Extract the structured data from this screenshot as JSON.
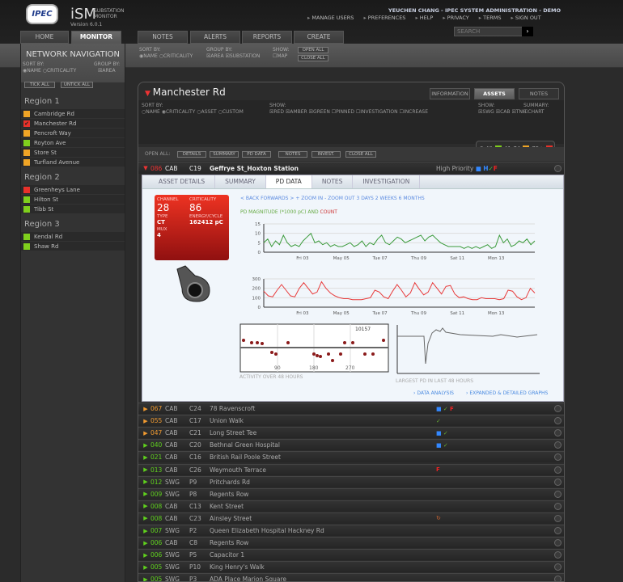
{
  "app": {
    "logo": "IPEC",
    "name": "iSM",
    "subtitle": "SUBSTATION MONITOR",
    "version": "Version 6.0.1"
  },
  "user": {
    "line": "YEUCHEN CHANG - IPEC SYSTEM ADMINISTRATION - DEMO",
    "links": [
      "MANAGE USERS",
      "PREFERENCES",
      "HELP",
      "PRIVACY",
      "TERMS",
      "SIGN OUT"
    ]
  },
  "search": {
    "placeholder": "SEARCH"
  },
  "tabs": [
    "HOME",
    "MONITOR",
    "NOTES",
    "ALERTS",
    "REPORTS",
    "CREATE"
  ],
  "active_tab": "MONITOR",
  "toolbar": {
    "sort_by": "SORT BY:",
    "sort_options": [
      "NAME",
      "CRITICALITY"
    ],
    "group_by": "GROUP BY:",
    "group_options": [
      "AREA",
      "SUBSTATION"
    ],
    "show": "SHOW:",
    "show_options": [
      "MAP"
    ],
    "open_all": "OPEN ALL",
    "close_all": "CLOSE ALL"
  },
  "nav": {
    "title": "NETWORK NAVIGATION",
    "sort_by": "SORT BY:",
    "sort_options": [
      "NAME",
      "CRITICALITY"
    ],
    "group_by": "GROUP BY:",
    "group_option": "AREA",
    "tick_all": "TICK ALL",
    "untick_all": "UNTICK ALL",
    "regions": [
      {
        "name": "Region 1",
        "items": [
          {
            "name": "Cambridge Rd",
            "status": "amber"
          },
          {
            "name": "Manchester Rd",
            "status": "red",
            "checked": true
          },
          {
            "name": "Pencroft Way",
            "status": "amber"
          },
          {
            "name": "Royton Ave",
            "status": "green"
          },
          {
            "name": "Store St",
            "status": "amber"
          },
          {
            "name": "Turfland Avenue",
            "status": "amber"
          }
        ]
      },
      {
        "name": "Region 2",
        "items": [
          {
            "name": "Greenheys Lane",
            "status": "red"
          },
          {
            "name": "Hilton St",
            "status": "green"
          },
          {
            "name": "Tibb St",
            "status": "green"
          }
        ]
      },
      {
        "name": "Region 3",
        "items": [
          {
            "name": "Kendal Rd",
            "status": "green"
          },
          {
            "name": "Shaw Rd",
            "status": "green"
          }
        ]
      }
    ]
  },
  "colors": {
    "red": "#e8312a",
    "amber": "#f0a526",
    "green": "#7fcf1d",
    "orange_text": "#f09a30",
    "green_text": "#5fd01d"
  },
  "panel": {
    "title": "Manchester Rd",
    "tabs": [
      "INFORMATION",
      "ASSETS",
      "NOTES"
    ],
    "active_tab": "ASSETS",
    "sort_label": "SORT BY:",
    "sort_options": [
      "NAME",
      "CRITICALITY",
      "ASSET",
      "CUSTOM"
    ],
    "show_label": "SHOW:",
    "show_options": [
      "RED",
      "AMBER",
      "GREEN",
      "PINNED",
      "INVESTIGATION",
      "INCREASE"
    ],
    "show2_label": "SHOW:",
    "show2_options": [
      "SWG",
      "CAB",
      "TNH"
    ],
    "summary_label": "SUMMARY:",
    "summary_option": "CHART",
    "legend": [
      "0-40",
      "41-74",
      "75+"
    ],
    "open_all_label": "OPEN ALL:",
    "open_buttons": [
      "DETAILS",
      "SUMMARY",
      "PD DATA",
      "NOTES",
      "INVEST.",
      "CLOSE ALL"
    ]
  },
  "expanded": {
    "num": "086",
    "type": "CAB",
    "code": "C19",
    "name": "Geffrye St_Hoxton Station",
    "priority": "High Priority",
    "tabs": [
      "ASSET DETAILS",
      "SUMMARY",
      "PD DATA",
      "NOTES",
      "INVESTIGATION"
    ],
    "active_tab": "PD DATA",
    "card": {
      "channel_label": "CHANNEL",
      "channel": "28",
      "crit_label": "CRITICALITY",
      "crit": "86",
      "type_label": "TYPE",
      "type": "CT",
      "energy_label": "ENERGY/CYCLE",
      "energy": "162412 pC",
      "mux_label": "MUX",
      "mux": "4"
    },
    "nav_links": "< BACK FORWARDS > + ZOOM IN - ZOOM OUT 3 DAYS 2 WEEKS 6 MONTHS",
    "pd_label_a": "PD MAGNITUDE (*1000 pC) AND ",
    "pd_label_b": "COUNT",
    "activity_label": "ACTIVITY OVER 48 HOURS",
    "largest_label": "LARGEST PD IN LAST 48 HOURS",
    "activity_value": "10157",
    "activity_ticks": [
      "90",
      "180",
      "270"
    ],
    "data_analysis": "DATA ANALYSIS",
    "expanded_graphs": "EXPANDED & DETAILED GRAPHS"
  },
  "chart_data": [
    {
      "type": "line",
      "title": "PD MAGNITUDE (*1000 pC)",
      "ylim": [
        0,
        15
      ],
      "yticks": [
        "0",
        "5",
        "10",
        "15"
      ],
      "xticks": [
        "Fri 03",
        "May 05",
        "Tue 07",
        "Thu 09",
        "Sat 11",
        "Mon 13"
      ],
      "series": [
        {
          "name": "magnitude",
          "color": "#3a9a3a",
          "values": [
            5,
            7,
            3,
            6,
            4,
            9,
            5,
            3,
            4,
            3,
            6,
            8,
            10,
            5,
            6,
            4,
            5,
            3,
            4,
            3,
            3,
            4,
            5,
            3,
            4,
            6,
            3,
            5,
            4,
            7,
            9,
            5,
            4,
            6,
            8,
            7,
            5,
            6,
            7,
            8,
            9,
            6,
            8,
            9,
            7,
            5,
            4,
            3,
            3,
            3,
            3,
            2,
            3,
            2,
            3,
            2,
            3,
            4,
            2,
            3,
            9,
            5,
            7,
            3,
            4,
            6,
            5,
            7,
            4,
            6
          ]
        }
      ]
    },
    {
      "type": "line",
      "title": "COUNT",
      "ylim": [
        0,
        300
      ],
      "yticks": [
        "0",
        "100",
        "200",
        "300"
      ],
      "xticks": [
        "Fri 03",
        "May 05",
        "Tue 07",
        "Thu 09",
        "Sat 11",
        "Mon 13"
      ],
      "series": [
        {
          "name": "count",
          "color": "#e83a3a",
          "values": [
            170,
            120,
            110,
            180,
            240,
            180,
            120,
            110,
            200,
            260,
            200,
            140,
            160,
            270,
            200,
            150,
            120,
            100,
            90,
            90,
            80,
            80,
            80,
            90,
            100,
            180,
            160,
            110,
            90,
            170,
            240,
            180,
            110,
            150,
            260,
            190,
            130,
            160,
            260,
            200,
            140,
            220,
            230,
            140,
            100,
            110,
            90,
            80,
            80,
            100,
            90,
            90,
            90,
            80,
            90,
            180,
            170,
            110,
            80,
            100,
            200,
            150
          ]
        }
      ]
    }
  ],
  "assets": [
    {
      "num": "067",
      "type": "CAB",
      "code": "C24",
      "name": "78 Ravenscroft",
      "level": "amber",
      "icons": [
        "blue",
        "check",
        "flag"
      ]
    },
    {
      "num": "055",
      "type": "CAB",
      "code": "C17",
      "name": "Union Walk",
      "level": "amber",
      "icons": [
        "check"
      ]
    },
    {
      "num": "047",
      "type": "CAB",
      "code": "C21",
      "name": "Long Street Tee",
      "level": "amber",
      "icons": [
        "blue",
        "check"
      ]
    },
    {
      "num": "040",
      "type": "CAB",
      "code": "C20",
      "name": "Bethnal Green Hospital",
      "level": "green",
      "icons": [
        "blue",
        "check"
      ]
    },
    {
      "num": "021",
      "type": "CAB",
      "code": "C16",
      "name": "British Rail Poole Street",
      "level": "green",
      "icons": []
    },
    {
      "num": "013",
      "type": "CAB",
      "code": "C26",
      "name": "Weymouth Terrace",
      "level": "green",
      "icons": [
        "flag"
      ]
    },
    {
      "num": "012",
      "type": "SWG",
      "code": "P9",
      "name": "Pritchards Rd",
      "level": "green",
      "icons": []
    },
    {
      "num": "009",
      "type": "SWG",
      "code": "P8",
      "name": "Regents Row",
      "level": "green",
      "icons": []
    },
    {
      "num": "008",
      "type": "CAB",
      "code": "C13",
      "name": "Kent Street",
      "level": "green",
      "icons": []
    },
    {
      "num": "008",
      "type": "CAB",
      "code": "C23",
      "name": "Ainsley Street",
      "level": "green",
      "icons": [
        "cycle"
      ]
    },
    {
      "num": "007",
      "type": "SWG",
      "code": "P2",
      "name": "Queen Elizabeth Hospital Hackney Rd",
      "level": "green",
      "icons": []
    },
    {
      "num": "006",
      "type": "CAB",
      "code": "C8",
      "name": "Regents Row",
      "level": "green",
      "icons": []
    },
    {
      "num": "006",
      "type": "SWG",
      "code": "P5",
      "name": "Capacitor 1",
      "level": "green",
      "icons": []
    },
    {
      "num": "005",
      "type": "SWG",
      "code": "P10",
      "name": "King Henry's Walk",
      "level": "green",
      "icons": []
    },
    {
      "num": "005",
      "type": "SWG",
      "code": "P3",
      "name": "ADA Place Marion Square",
      "level": "green",
      "icons": []
    }
  ]
}
